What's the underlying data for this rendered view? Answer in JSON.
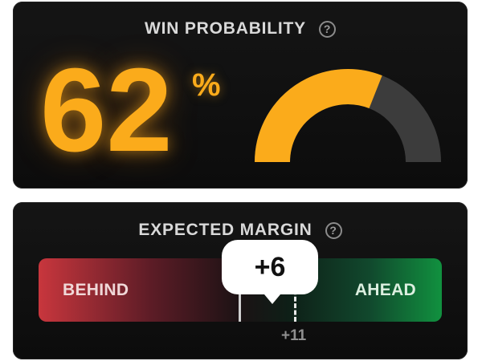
{
  "win_probability": {
    "title": "WIN PROBABILITY",
    "help_icon": "?",
    "value": "62",
    "unit": "%",
    "gauge": {
      "fraction": 0.62,
      "fill_color": "#fbab1b",
      "track_color": "#3c3c3c"
    }
  },
  "expected_margin": {
    "title": "EXPECTED MARGIN",
    "help_icon": "?",
    "behind_label": "BEHIND",
    "ahead_label": "AHEAD",
    "callout_value": "+6",
    "projection_label": "+11",
    "colors": {
      "behind": "#c8363d",
      "ahead": "#11913f"
    }
  }
}
